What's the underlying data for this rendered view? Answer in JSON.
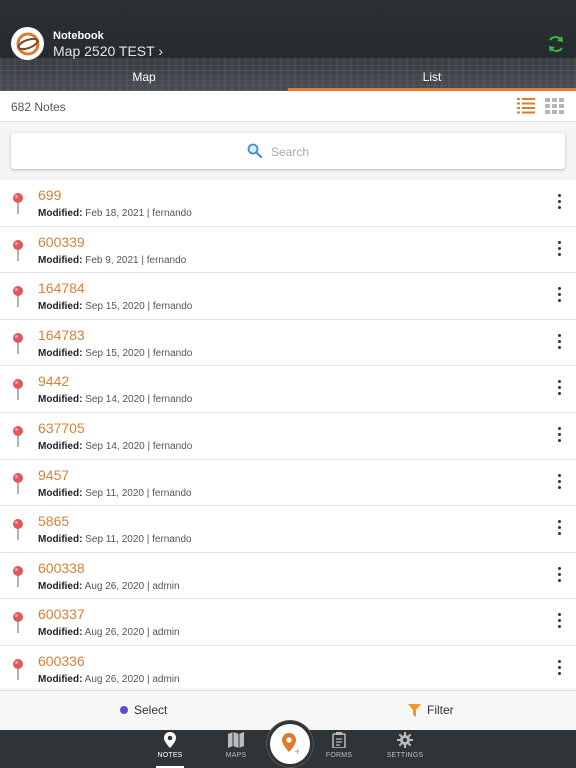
{
  "header": {
    "app_label": "Notebook",
    "map_title": "Map 2520 TEST ›",
    "segments": [
      "Map",
      "List"
    ],
    "selected_segment": "List"
  },
  "notes": {
    "count_label": "682 Notes"
  },
  "search": {
    "placeholder": "Search"
  },
  "list": [
    {
      "title": "699",
      "modified_label": "Modified:",
      "meta": "Feb 18, 2021 | fernando"
    },
    {
      "title": "600339",
      "modified_label": "Modified:",
      "meta": "Feb 9, 2021 | fernando"
    },
    {
      "title": "164784",
      "modified_label": "Modified:",
      "meta": "Sep 15, 2020 | fernando"
    },
    {
      "title": "164783",
      "modified_label": "Modified:",
      "meta": "Sep 15, 2020 | fernando"
    },
    {
      "title": "9442",
      "modified_label": "Modified:",
      "meta": "Sep 14, 2020 | fernando"
    },
    {
      "title": "637705",
      "modified_label": "Modified:",
      "meta": "Sep 14, 2020 | fernando"
    },
    {
      "title": "9457",
      "modified_label": "Modified:",
      "meta": "Sep 11, 2020 | fernando"
    },
    {
      "title": "5865",
      "modified_label": "Modified:",
      "meta": "Sep 11, 2020 | fernando"
    },
    {
      "title": "600338",
      "modified_label": "Modified:",
      "meta": "Aug 26, 2020 | admin"
    },
    {
      "title": "600337",
      "modified_label": "Modified:",
      "meta": "Aug 26, 2020 | admin"
    },
    {
      "title": "600336",
      "modified_label": "Modified:",
      "meta": "Aug 26, 2020 | admin"
    }
  ],
  "actions": {
    "select_label": "Select",
    "filter_label": "Filter"
  },
  "tabs": [
    {
      "label": "NOTES",
      "icon": "pin-icon",
      "active": true
    },
    {
      "label": "MAPS",
      "icon": "map-icon",
      "active": false
    },
    {
      "label": "FORMS",
      "icon": "clipboard-icon",
      "active": false
    },
    {
      "label": "SETTINGS",
      "icon": "gear-icon",
      "active": false
    }
  ],
  "colors": {
    "accent": "#e07a2e",
    "note_title": "#d4823a",
    "pin": "#e2585a",
    "sync": "#3cb44b",
    "header_bg": "#2b3034",
    "tabbar_bg": "#2f3438"
  }
}
